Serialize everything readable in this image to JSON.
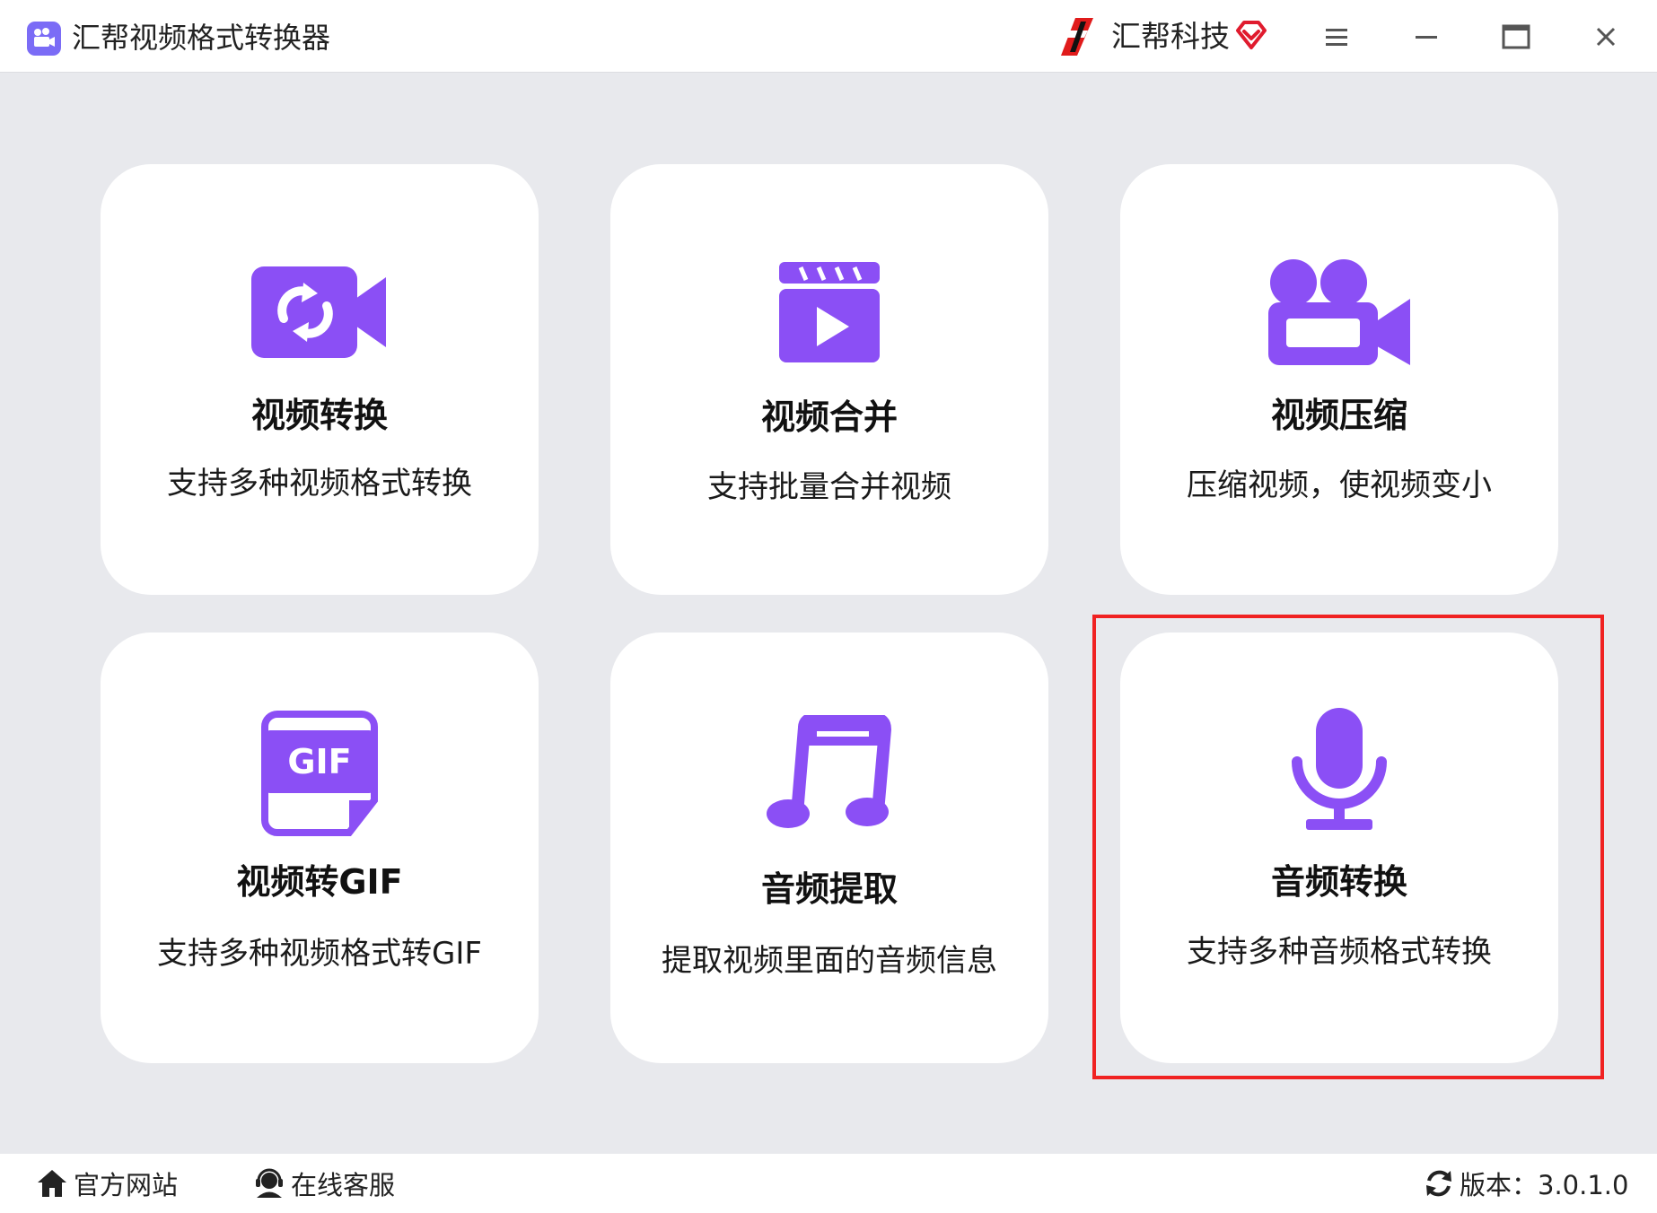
{
  "titlebar": {
    "app_title": "汇帮视频格式转换器",
    "brand_name": "汇帮科技",
    "controls": [
      "menu-icon",
      "minimize-icon",
      "maximize-icon",
      "close-icon"
    ]
  },
  "cards": [
    {
      "title": "视频转换",
      "desc": "支持多种视频格式转换",
      "icon": "video-convert-icon"
    },
    {
      "title": "视频合并",
      "desc": "支持批量合并视频",
      "icon": "clapperboard-play-icon"
    },
    {
      "title": "视频压缩",
      "desc": "压缩视频，使视频变小",
      "icon": "movie-camera-icon"
    },
    {
      "title": "视频转GIF",
      "desc": "支持多种视频格式转GIF",
      "icon": "gif-file-icon"
    },
    {
      "title": "音频提取",
      "desc": "提取视频里面的音频信息",
      "icon": "music-note-icon"
    },
    {
      "title": "音频转换",
      "desc": "支持多种音频格式转换",
      "icon": "microphone-icon"
    }
  ],
  "footer": {
    "website": "官方网站",
    "support": "在线客服",
    "version": "版本：3.0.1.0"
  },
  "colors": {
    "accent": "#8b4ff5",
    "highlight": "#f02222",
    "background": "#e8e9ed"
  }
}
